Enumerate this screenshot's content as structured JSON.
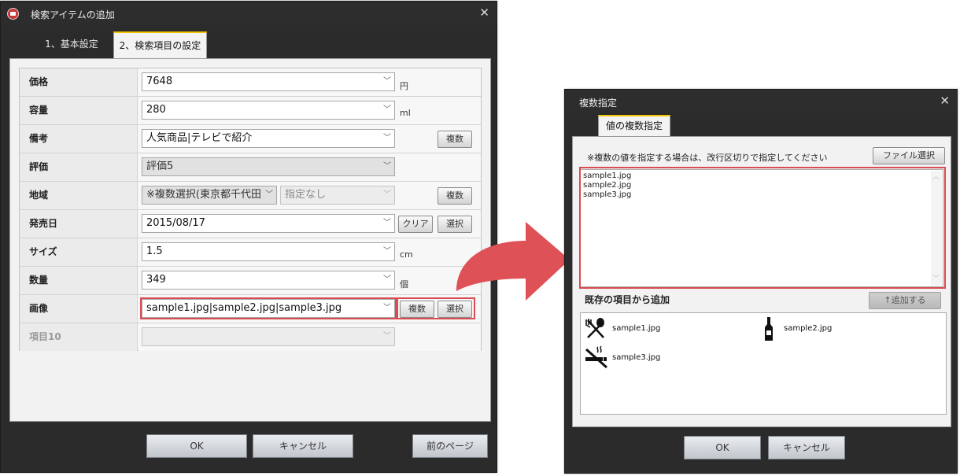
{
  "left_dialog": {
    "title": "検索アイテムの追加",
    "tabs": [
      "1、基本設定",
      "2、検索項目の設定"
    ],
    "rows": [
      {
        "label": "価格",
        "value": "7648",
        "unit": "円"
      },
      {
        "label": "容量",
        "value": "280",
        "unit": "ml"
      },
      {
        "label": "備考",
        "value": "人気商品|テレビで紹介",
        "button": "複数"
      },
      {
        "label": "評価",
        "value": "評価5"
      },
      {
        "label": "地域",
        "value": "※複数選択(東京都千代田",
        "value2": "指定なし",
        "button": "複数"
      },
      {
        "label": "発売日",
        "value": "2015/08/17",
        "button": "クリア",
        "button2": "選択"
      },
      {
        "label": "サイズ",
        "value": "1.5",
        "unit": "cm"
      },
      {
        "label": "数量",
        "value": "349",
        "unit": "個"
      },
      {
        "label": "画像",
        "value": "sample1.jpg|sample2.jpg|sample3.jpg",
        "button": "複数",
        "button2": "選択"
      },
      {
        "label": "項目10",
        "value": ""
      }
    ],
    "footer": {
      "ok": "OK",
      "cancel": "キャンセル",
      "prev": "前のページ"
    }
  },
  "right_dialog": {
    "title": "複数指定",
    "tab": "値の複数指定",
    "instruction": "※複数の値を指定する場合は、改行区切りで指定してください",
    "file_select": "ファイル選択",
    "textarea_lines": [
      "sample1.jpg",
      "sample2.jpg",
      "sample3.jpg"
    ],
    "existing_header": "既存の項目から追加",
    "add_button": "↑追加する",
    "items": [
      {
        "label": "sample1.jpg",
        "icon": "fork-spoon-icon"
      },
      {
        "label": "sample2.jpg",
        "icon": "bottle-icon"
      },
      {
        "label": "sample3.jpg",
        "icon": "no-smoking-icon"
      }
    ],
    "footer": {
      "ok": "OK",
      "cancel": "キャンセル"
    }
  },
  "colors": {
    "highlight": "#d84c52",
    "arrow": "#de5257",
    "tab_accent": "#f0c400",
    "dialog_dark": "#2b2b2b"
  }
}
